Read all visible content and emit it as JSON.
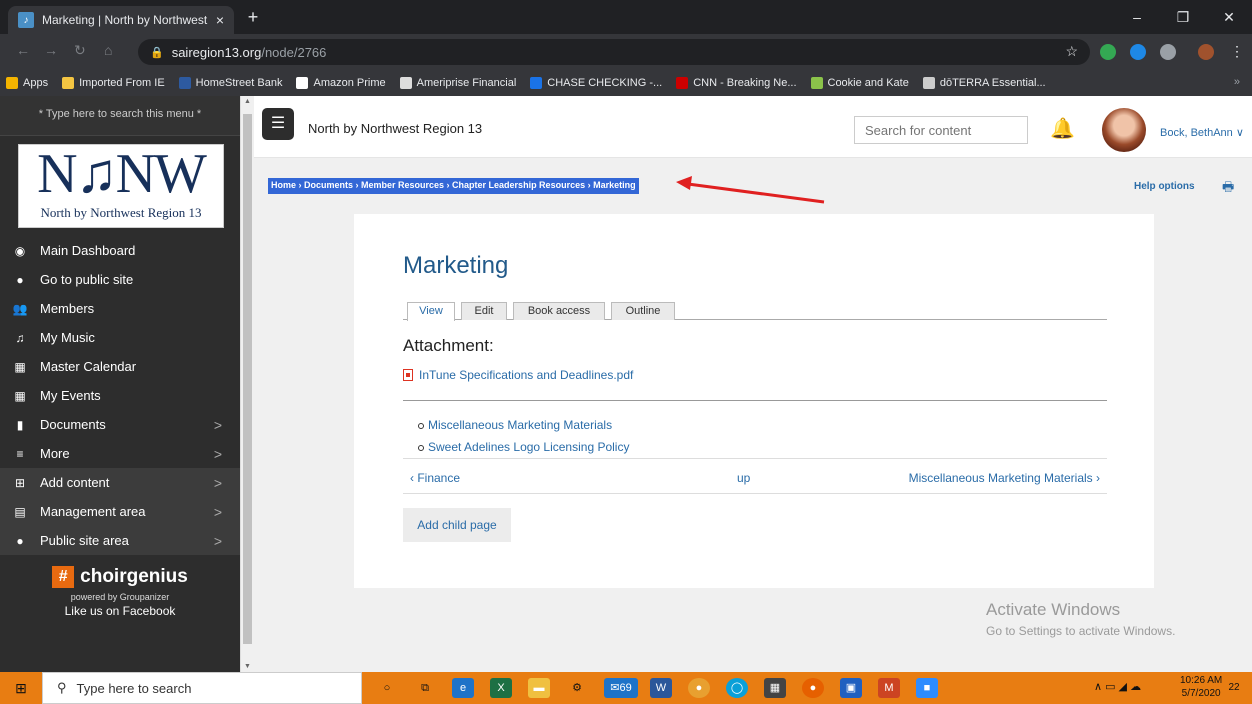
{
  "browser": {
    "tab_title": "Marketing | North by Northwest",
    "tab_close": "×",
    "new_tab": "+",
    "window_controls": {
      "minimize": "–",
      "restore": "❐",
      "close": "✕"
    },
    "url_domain": "sairegion13.org",
    "url_path": "/node/2766",
    "bookmarks": [
      {
        "label": "Apps",
        "color": "#f4b400"
      },
      {
        "label": "Imported From IE",
        "color": "#f4c542"
      },
      {
        "label": "HomeStreet Bank",
        "color": "#2d5aa0"
      },
      {
        "label": "Amazon Prime",
        "color": "#ffffff"
      },
      {
        "label": "Ameriprise Financial",
        "color": "#dddddd"
      },
      {
        "label": "CHASE CHECKING -...",
        "color": "#1a73e8"
      },
      {
        "label": "CNN - Breaking Ne...",
        "color": "#cc0000"
      },
      {
        "label": "Cookie and Kate",
        "color": "#8bc34a"
      },
      {
        "label": "dōTERRA Essential...",
        "color": "#cccccc"
      }
    ],
    "bookmarks_more": "»"
  },
  "sidebar": {
    "search_hint": "* Type here to search this menu *",
    "logo_letters": "N♫NW",
    "logo_subtitle": "North by Northwest Region 13",
    "items": [
      {
        "label": "Main Dashboard",
        "icon": "dashboard-icon",
        "glyph": "◉",
        "chevron": false,
        "dark": false
      },
      {
        "label": "Go to public site",
        "icon": "globe-icon",
        "glyph": "●",
        "chevron": false,
        "dark": false
      },
      {
        "label": "Members",
        "icon": "members-icon",
        "glyph": "👥",
        "chevron": false,
        "dark": false
      },
      {
        "label": "My Music",
        "icon": "music-icon",
        "glyph": "♫",
        "chevron": false,
        "dark": false
      },
      {
        "label": "Master Calendar",
        "icon": "calendar-icon",
        "glyph": "▦",
        "chevron": false,
        "dark": false
      },
      {
        "label": "My Events",
        "icon": "events-icon",
        "glyph": "▦",
        "chevron": false,
        "dark": false
      },
      {
        "label": "Documents",
        "icon": "document-icon",
        "glyph": "▮",
        "chevron": true,
        "dark": false
      },
      {
        "label": "More",
        "icon": "more-icon",
        "glyph": "≡",
        "chevron": true,
        "dark": false
      },
      {
        "label": "Add content",
        "icon": "plus-icon",
        "glyph": "⊞",
        "chevron": true,
        "dark": true
      },
      {
        "label": "Management area",
        "icon": "management-icon",
        "glyph": "▤",
        "chevron": true,
        "dark": true
      },
      {
        "label": "Public site area",
        "icon": "globe-icon",
        "glyph": "●",
        "chevron": true,
        "dark": true
      }
    ],
    "chevron": ">",
    "choirgenius": "choirgenius",
    "powered_by": "powered by Groupanizer",
    "facebook": "Like us on Facebook"
  },
  "header": {
    "site_name": "North by Northwest Region 13",
    "search_placeholder": "Search for content",
    "username": "Bock, BethAnn ∨"
  },
  "content": {
    "breadcrumb": "Home › Documents › Member Resources › Chapter Leadership Resources › Marketing",
    "help_options": "Help options",
    "title": "Marketing",
    "tabs": [
      {
        "label": "View",
        "active": true
      },
      {
        "label": "Edit",
        "active": false
      },
      {
        "label": "Book access",
        "active": false
      },
      {
        "label": "Outline",
        "active": false
      }
    ],
    "attachment_heading": "Attachment:",
    "attachment_file": "InTune Specifications and Deadlines.pdf",
    "child_pages": [
      "Miscellaneous Marketing Materials",
      "Sweet Adelines Logo Licensing Policy"
    ],
    "nav_prev": "‹ Finance",
    "nav_up": "up",
    "nav_next": "Miscellaneous Marketing Materials ›",
    "add_child": "Add child page"
  },
  "watermark": {
    "line1": "Activate Windows",
    "line2": "Go to Settings to activate Windows."
  },
  "taskbar": {
    "search_placeholder": "Type here to search",
    "mail_badge": "69",
    "time": "10:26 AM",
    "date": "5/7/2020",
    "notifications": "22"
  }
}
